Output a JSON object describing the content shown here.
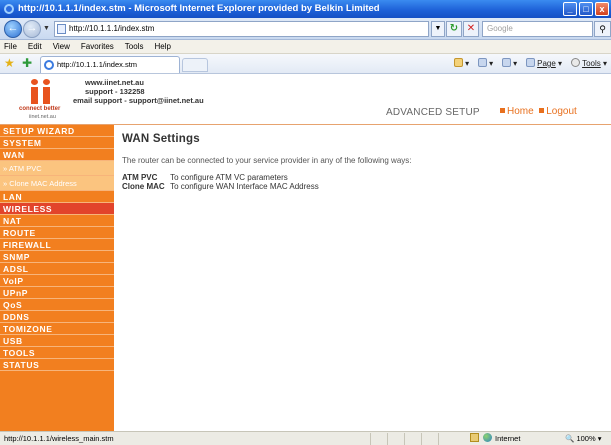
{
  "window": {
    "title": "http://10.1.1.1/index.stm - Microsoft Internet Explorer provided by Belkin Limited",
    "minimize": "_",
    "maximize": "□",
    "close": "x"
  },
  "address_bar": {
    "url": "http://10.1.1.1/index.stm",
    "search_placeholder": "Google"
  },
  "menu": [
    "File",
    "Edit",
    "View",
    "Favorites",
    "Tools",
    "Help"
  ],
  "tabs": [
    {
      "label": "http://10.1.1.1/index.stm"
    }
  ],
  "command_bar": {
    "page": "Page",
    "tools": "Tools"
  },
  "header": {
    "tagline": "connect better",
    "logo_url": "iinet.net.au",
    "contact": {
      "website": "www.iinet.net.au",
      "support": "support - 132258",
      "email": "email support - support@iinet.net.au"
    },
    "section": "ADVANCED SETUP",
    "home_link": "Home",
    "logout_link": "Logout"
  },
  "sidebar": {
    "items": [
      {
        "label": "SETUP WIZARD",
        "type": "main"
      },
      {
        "label": "SYSTEM",
        "type": "main"
      },
      {
        "label": "WAN",
        "type": "main"
      },
      {
        "label": "» ATM PVC",
        "type": "sub"
      },
      {
        "label": "» Clone MAC Address",
        "type": "sub"
      },
      {
        "label": "LAN",
        "type": "main"
      },
      {
        "label": "WIRELESS",
        "type": "active"
      },
      {
        "label": "NAT",
        "type": "main"
      },
      {
        "label": "ROUTE",
        "type": "main"
      },
      {
        "label": "FIREWALL",
        "type": "main"
      },
      {
        "label": "SNMP",
        "type": "main"
      },
      {
        "label": "ADSL",
        "type": "main"
      },
      {
        "label": "VoIP",
        "type": "main"
      },
      {
        "label": "UPnP",
        "type": "main"
      },
      {
        "label": "QoS",
        "type": "main"
      },
      {
        "label": "DDNS",
        "type": "main"
      },
      {
        "label": "TOMIZONE",
        "type": "main"
      },
      {
        "label": "USB",
        "type": "main"
      },
      {
        "label": "TOOLS",
        "type": "main"
      },
      {
        "label": "STATUS",
        "type": "main"
      }
    ]
  },
  "main": {
    "title": "WAN Settings",
    "intro": "The router can be connected to your service provider in any of the following ways:",
    "options": [
      {
        "key": "ATM PVC",
        "value": "To configure ATM VC parameters"
      },
      {
        "key": "Clone MAC",
        "value": "To configure WAN Interface MAC Address"
      }
    ]
  },
  "status_bar": {
    "url": "http://10.1.1.1/wireless_main.stm",
    "zone": "Internet",
    "zoom": "100%"
  },
  "colors": {
    "sidebar_bg": "#f27f1f",
    "sidebar_active": "#e2442b",
    "sidebar_sub": "#fbc47f",
    "accent_orange": "#e8701e"
  }
}
